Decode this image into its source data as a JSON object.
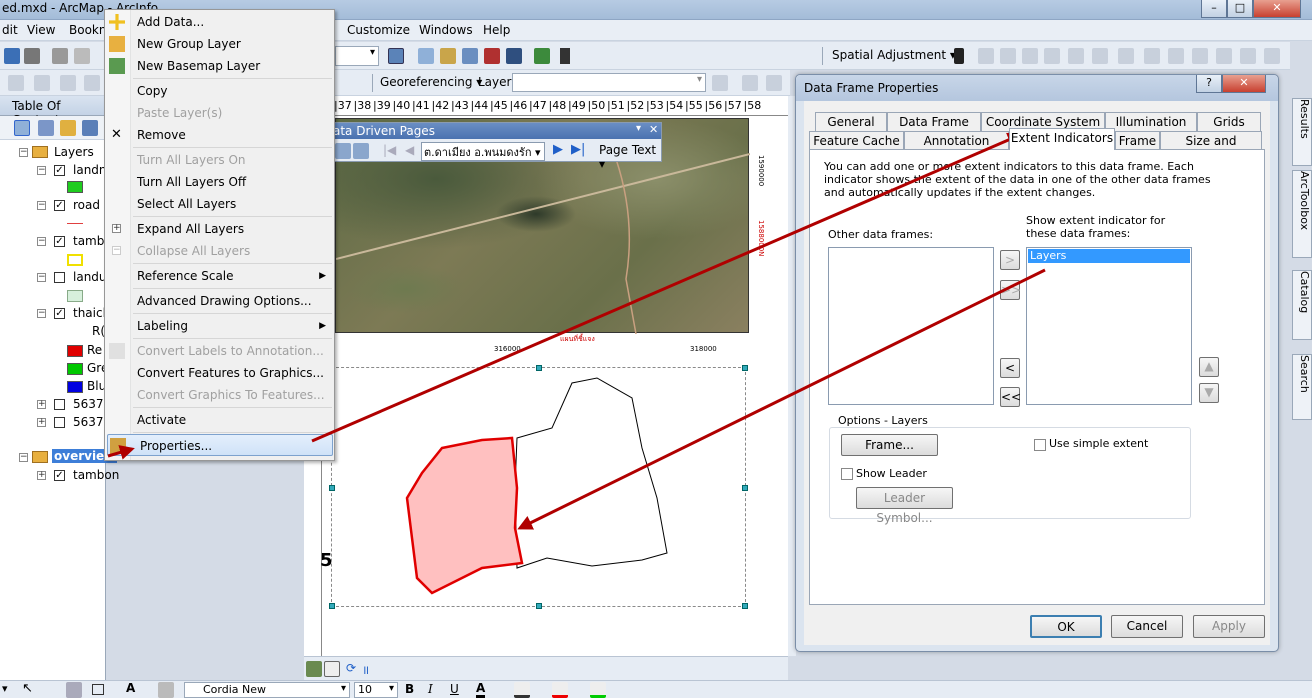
{
  "app": {
    "title": "ed.mxd - ArcMap - ArcInfo",
    "minimize": "–",
    "maximize": "□",
    "close": "✕"
  },
  "menubar": {
    "items": [
      "dit",
      "View",
      "Bookn",
      "Customize",
      "Windows",
      "Help"
    ]
  },
  "toolbars": {
    "spatial_adjustment": "Spatial Adjustment ▾",
    "georeferencing": "Georeferencing ▾",
    "layer_label": "Layer:",
    "font_name": "Cordia New",
    "font_size": "10",
    "bold": "B",
    "italic": "I",
    "underline": "U",
    "font_color": "A"
  },
  "toc": {
    "title": "Table Of Content",
    "rows": [
      {
        "label": "Layers"
      },
      {
        "label": "landn"
      },
      {
        "label": "road"
      },
      {
        "label": "tamb"
      },
      {
        "label": "landu"
      },
      {
        "label": "thaicl"
      },
      {
        "label": "R("
      },
      {
        "label": "Re"
      },
      {
        "label": "Gre"
      },
      {
        "label": "Blu"
      },
      {
        "label": "56371V"
      },
      {
        "label": "56371"
      },
      {
        "label": "overview"
      },
      {
        "label": "tambon"
      }
    ],
    "colors": {
      "green": "#1fcc1f",
      "red_line": "#e04040",
      "yellow": "#f0e000",
      "pale_green": "#d7f0dc",
      "red": "#e00000",
      "green2": "#00c800",
      "blue": "#0000e0"
    }
  },
  "context_menu": {
    "items": [
      {
        "label": "Add Data...",
        "disabled": false
      },
      {
        "label": "New Group Layer",
        "disabled": false
      },
      {
        "label": "New Basemap Layer",
        "disabled": false
      },
      {
        "label": "Copy",
        "disabled": false
      },
      {
        "label": "Paste Layer(s)",
        "disabled": true
      },
      {
        "label": "Remove",
        "disabled": false
      },
      {
        "label": "Turn All Layers On",
        "disabled": true
      },
      {
        "label": "Turn All Layers Off",
        "disabled": false
      },
      {
        "label": "Select All Layers",
        "disabled": false
      },
      {
        "label": "Expand All Layers",
        "disabled": false
      },
      {
        "label": "Collapse All Layers",
        "disabled": true
      },
      {
        "label": "Reference Scale",
        "disabled": false
      },
      {
        "label": "Advanced Drawing Options...",
        "disabled": false
      },
      {
        "label": "Labeling",
        "disabled": false
      },
      {
        "label": "Convert Labels to Annotation...",
        "disabled": true
      },
      {
        "label": "Convert Features to Graphics...",
        "disabled": false
      },
      {
        "label": "Convert Graphics To Features...",
        "disabled": true
      },
      {
        "label": "Activate",
        "disabled": false
      },
      {
        "label": "Properties...",
        "disabled": false
      }
    ]
  },
  "ruler": {
    "top_ticks": [
      "37",
      "38",
      "39",
      "40",
      "41",
      "42",
      "43",
      "44",
      "45",
      "46",
      "47",
      "48",
      "49",
      "50",
      "51",
      "52",
      "53",
      "54",
      "55",
      "56",
      "57",
      "58"
    ]
  },
  "ddp_toolbar": {
    "title": "ata Driven Pages",
    "page_name": "ต.ดาเมียง อ.พนมดงรัก ▾",
    "page_text": "Page Text ▾"
  },
  "map": {
    "coord_a": "318000",
    "coord_b": "316000",
    "coord_c": "318000",
    "coord_d": "1590000",
    "coord_e": "แผนที่ชี้แจง",
    "coord_red": "1588000N",
    "big_char": "5"
  },
  "dialog": {
    "title": "Data Frame Properties",
    "help": "?",
    "close": "✕",
    "tabs_row1": [
      "General",
      "Data Frame",
      "Coordinate System",
      "Illumination",
      "Grids"
    ],
    "tabs_row2": [
      "Feature Cache",
      "Annotation Groups",
      "Extent Indicators",
      "Frame",
      "Size and Position"
    ],
    "description": "You can add one or more extent indicators to this data frame.  Each indicator shows the extent of the data in one of the other data frames and automatically updates if the extent changes.",
    "other_frames_label": "Other data frames:",
    "show_indicator_label": "Show extent indicator for these data frames:",
    "selected_frames": [
      "Layers"
    ],
    "move_right": ">",
    "move_all_right": ">>",
    "move_left": "<",
    "move_all_left": "<<",
    "options_group": "Options - Layers",
    "frame_button": "Frame...",
    "use_simple_extent": "Use simple extent",
    "show_leader": "Show Leader",
    "leader_symbol": "Leader Symbol...",
    "ok": "OK",
    "cancel": "Cancel",
    "apply": "Apply"
  },
  "right_dock": {
    "tabs": [
      "Results",
      "ArcToolbox",
      "Catalog",
      "Search"
    ]
  }
}
